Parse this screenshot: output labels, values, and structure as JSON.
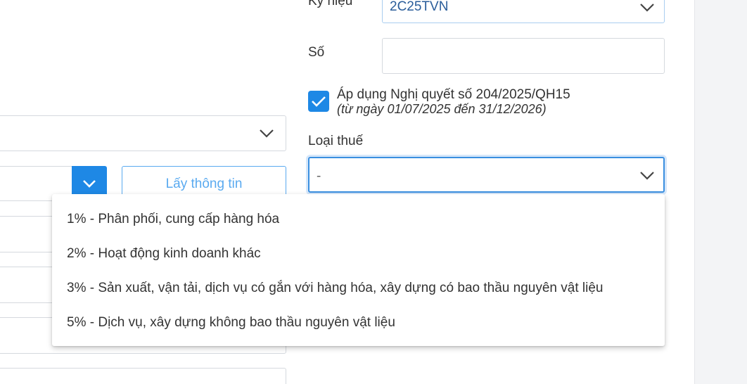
{
  "form": {
    "symbol_label": "Ký hiệu",
    "symbol_value": "2C25TVN",
    "number_label": "Số",
    "number_value": "",
    "resolution_checked": true,
    "resolution_label": "Áp dụng Nghị quyết số 204/2025/QH15",
    "resolution_note": "(từ ngày 01/07/2025 đến 31/12/2026)",
    "tax_type_label": "Loại thuế",
    "tax_type_value": "-",
    "fetch_info_button": "Lấy thông tin"
  },
  "tax_type_options": [
    "1% - Phân phối, cung cấp hàng hóa",
    "2% - Hoạt động kinh doanh khác",
    "3% - Sản xuất, vận tải, dịch vụ có gắn với hàng hóa, xây dựng có bao thầu nguyên vật liệu",
    "5% - Dịch vụ, xây dựng không bao thầu nguyên vật liệu"
  ],
  "colors": {
    "accent": "#1e88e5",
    "focus_border": "#3a8fe0",
    "outline_button": "#5aaaf0"
  }
}
